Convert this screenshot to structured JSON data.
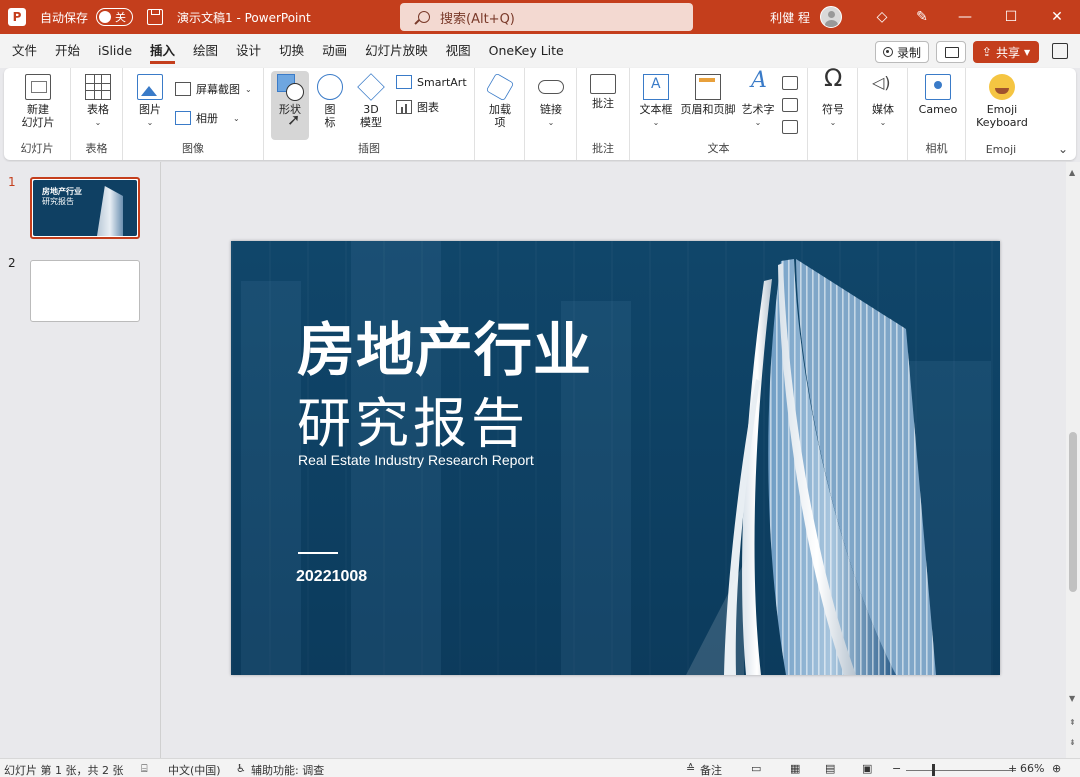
{
  "titlebar": {
    "app_icon": "P",
    "autosave_label": "自动保存",
    "autosave_state": "关",
    "doc_title": "演示文稿1  -  PowerPoint",
    "search_placeholder": "搜索(Alt+Q)",
    "username": "利健 程"
  },
  "menu": {
    "tabs": [
      "文件",
      "开始",
      "iSlide",
      "插入",
      "绘图",
      "设计",
      "切换",
      "动画",
      "幻灯片放映",
      "视图",
      "OneKey Lite"
    ],
    "active_tab": "插入",
    "record_label": "录制",
    "share_label": "共享"
  },
  "ribbon": {
    "new_slide": "新建\n幻灯片",
    "table": "表格",
    "picture": "图片",
    "screenshot": "屏幕截图",
    "album": "相册",
    "shapes": "形状",
    "icons": "图\n标",
    "model3d": "3D\n模型",
    "smartart": "SmartArt",
    "chart": "图表",
    "addins": "加载\n项",
    "link": "链接",
    "comment": "批注",
    "textbox": "文本框",
    "header_footer": "页眉和页脚",
    "wordart": "艺术字",
    "symbol": "符号",
    "media": "媒体",
    "cameo": "Cameo",
    "emoji": "Emoji\nKeyboard",
    "groups": {
      "slides": "幻灯片",
      "tables": "表格",
      "images": "图像",
      "illustrations": "插图",
      "comments": "批注",
      "text": "文本",
      "camera": "相机",
      "emoji": "Emoji"
    }
  },
  "thumbnails": [
    {
      "num": "1",
      "title": "房地产行业",
      "sub": "研究报告"
    },
    {
      "num": "2"
    }
  ],
  "slide": {
    "title_line1": "房地产行业",
    "title_line2": "研究报告",
    "subtitle_en": "Real Estate Industry Research Report",
    "date": "20221008"
  },
  "status": {
    "slide_info": "幻灯片 第 1 张，共 2 张",
    "language": "中文(中国)",
    "accessibility": "辅助功能: 调查",
    "notes": "备注",
    "zoom": "66%"
  },
  "colors": {
    "accent": "#c43e1c",
    "slide_bg": "#0f4467"
  }
}
